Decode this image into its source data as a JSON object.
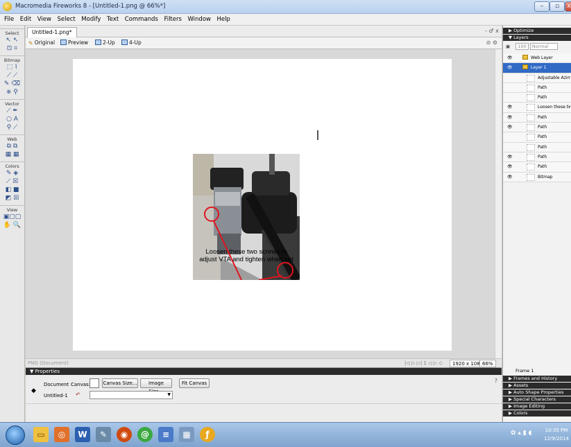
{
  "window": {
    "title": "Macromedia Fireworks 8 - [Untitled-1.png @ 66%*]",
    "min": "–",
    "restore": "▫",
    "close": "x"
  },
  "menu": [
    "File",
    "Edit",
    "View",
    "Select",
    "Modify",
    "Text",
    "Commands",
    "Filters",
    "Window",
    "Help"
  ],
  "tools": {
    "select": "Select",
    "bitmap": "Bitmap",
    "vector": "Vector",
    "web": "Web",
    "colors": "Colors",
    "view": "View"
  },
  "document": {
    "tab": "Untitled-1.png*",
    "tab_controls": "- ♂ x",
    "views": {
      "original": "Original",
      "preview": "Preview",
      "two_up": "2-Up",
      "four_up": "4-Up"
    },
    "caption_line1": "Loosen these two screws to",
    "caption_line2": "adjust VTA and tighten when set"
  },
  "status": {
    "type": "PNG (Document)",
    "frame_controls": "|◁ ▷ ▷| 1 ◁ ▷ ◇",
    "size": "1920 x 1080",
    "zoom": "66%"
  },
  "properties": {
    "header": "▼ Properties",
    "doc_label": "Document",
    "doc_name": "Untitled-1",
    "canvas_label": "Canvas:",
    "canvas_size_btn": "Canvas Size...",
    "image_size_btn": "Image Size...",
    "fit_canvas_btn": "Fit Canvas"
  },
  "panels": {
    "optimize": "▶ Optimize",
    "layers": "▼ Layers",
    "opacity": "100",
    "blend": "Normal",
    "layer_rows": [
      {
        "name": "Web Layer",
        "folder": true,
        "eye": "👁"
      },
      {
        "name": "Layer 1",
        "folder": true,
        "selected": true,
        "eye": "👁"
      },
      {
        "name": "Adjustable Azimut...",
        "eye": ""
      },
      {
        "name": "Path",
        "eye": ""
      },
      {
        "name": "Path",
        "eye": ""
      },
      {
        "name": "Loosen these two ...",
        "eye": "👁"
      },
      {
        "name": "Path",
        "eye": "👁"
      },
      {
        "name": "Path",
        "eye": "👁"
      },
      {
        "name": "Path",
        "eye": ""
      },
      {
        "name": "Path",
        "eye": ""
      },
      {
        "name": "Path",
        "eye": "👁"
      },
      {
        "name": "Path",
        "eye": "👁"
      },
      {
        "name": "Bitmap",
        "eye": "👁"
      }
    ],
    "frame": "Frame 1",
    "frames_history": "▶ Frames and History",
    "assets": "▶ Assets",
    "auto_shape": "▶ Auto Shape Properties",
    "special_chars": "▶ Special Characters",
    "image_editing": "▶ Image Editing",
    "colors": "▶ Colors"
  },
  "taskbar": {
    "time": "10:35 PM",
    "date": "12/9/2014"
  },
  "colors": {
    "selection": "#316ac5",
    "annotation": "#e0151e"
  }
}
